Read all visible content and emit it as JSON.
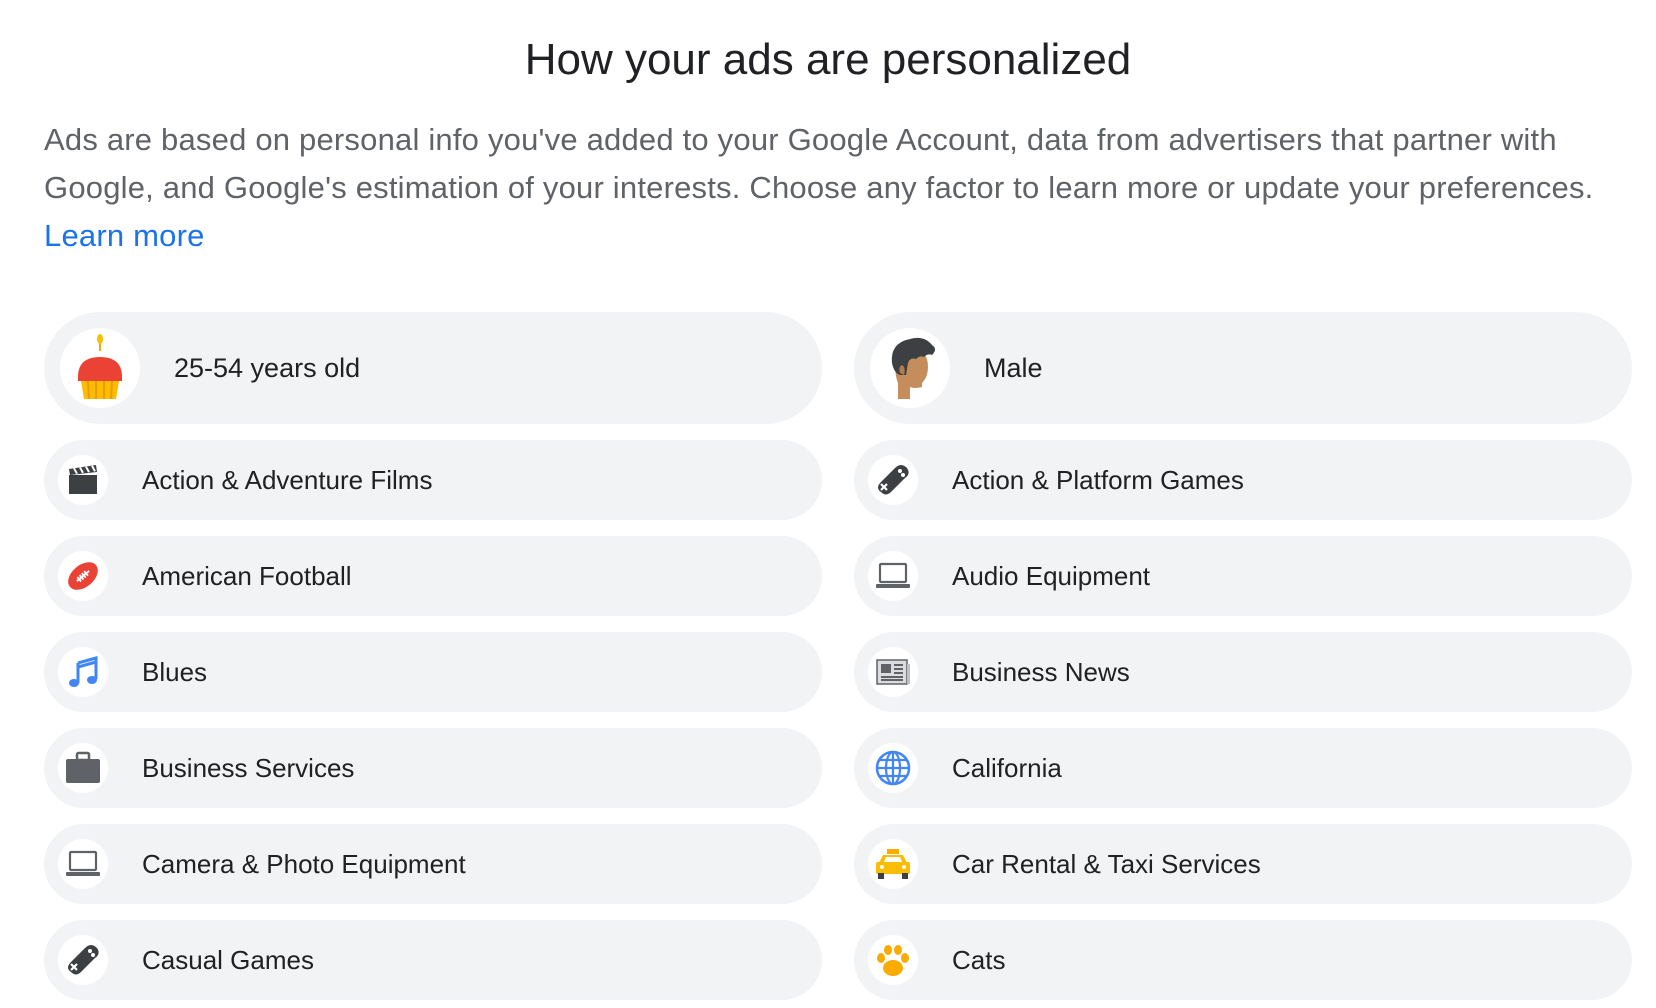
{
  "title": "How your ads are personalized",
  "intro": {
    "text": "Ads are based on personal info you've added to your Google Account, data from advertisers that partner with Google, and Google's estimation of your interests. Choose any factor to learn more or update your preferences.",
    "link": "Learn more"
  },
  "factors": [
    {
      "label": "25-54 years old",
      "icon": "birthday-cake-icon"
    },
    {
      "label": "Male",
      "icon": "person-avatar-icon"
    },
    {
      "label": "Action & Adventure Films",
      "icon": "clapperboard-icon"
    },
    {
      "label": "Action & Platform Games",
      "icon": "gamepad-icon"
    },
    {
      "label": "American Football",
      "icon": "football-icon"
    },
    {
      "label": "Audio Equipment",
      "icon": "laptop-icon"
    },
    {
      "label": "Blues",
      "icon": "music-note-icon"
    },
    {
      "label": "Business News",
      "icon": "newspaper-icon"
    },
    {
      "label": "Business Services",
      "icon": "briefcase-icon"
    },
    {
      "label": "California",
      "icon": "globe-icon"
    },
    {
      "label": "Camera & Photo Equipment",
      "icon": "laptop-icon"
    },
    {
      "label": "Car Rental & Taxi Services",
      "icon": "taxi-icon"
    },
    {
      "label": "Casual Games",
      "icon": "gamepad-icon"
    },
    {
      "label": "Cats",
      "icon": "paw-icon"
    }
  ],
  "colors": {
    "link": "#1a73e8",
    "pill_background": "#f1f3f4",
    "text": "#202124",
    "secondary_text": "#5f6368"
  }
}
